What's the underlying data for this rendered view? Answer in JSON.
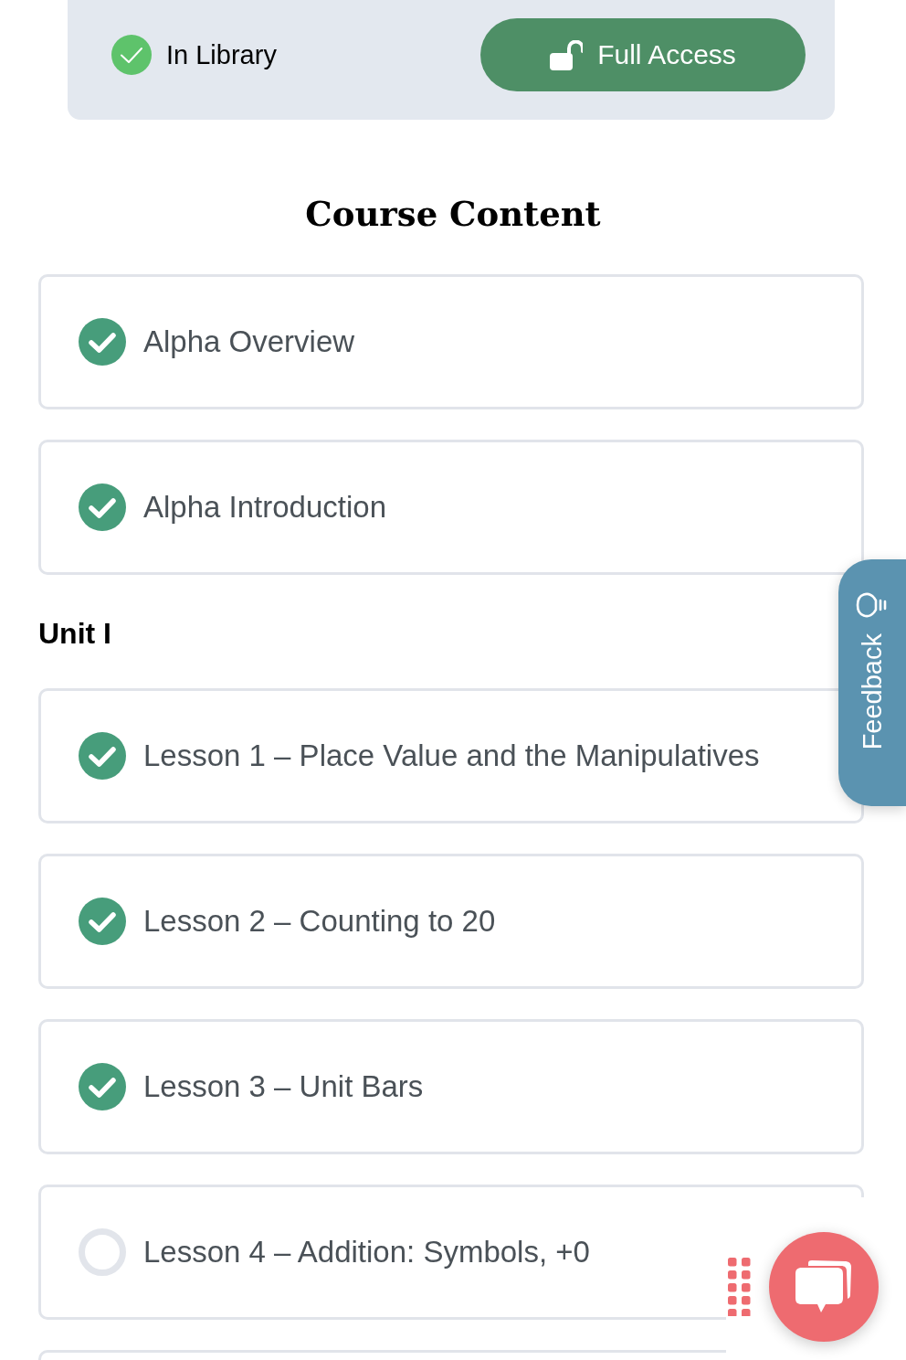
{
  "library_panel": {
    "status_label": "In Library",
    "access_button": "Full Access"
  },
  "course_content": {
    "title": "Course Content",
    "items": [
      {
        "kind": "lesson",
        "title": "Alpha Overview",
        "completed": true
      },
      {
        "kind": "lesson",
        "title": "Alpha Introduction",
        "completed": true
      },
      {
        "kind": "heading",
        "title": "Unit I"
      },
      {
        "kind": "lesson",
        "title": "Lesson 1 – Place Value and the Manipulatives",
        "completed": true
      },
      {
        "kind": "lesson",
        "title": "Lesson 2 – Counting to 20",
        "completed": true
      },
      {
        "kind": "lesson",
        "title": "Lesson 3 – Unit Bars",
        "completed": true
      },
      {
        "kind": "lesson",
        "title": "Lesson 4 – Addition: Symbols, +0",
        "completed": false
      },
      {
        "kind": "lesson"
      }
    ]
  },
  "feedback_tab": {
    "label": "Feedback"
  }
}
